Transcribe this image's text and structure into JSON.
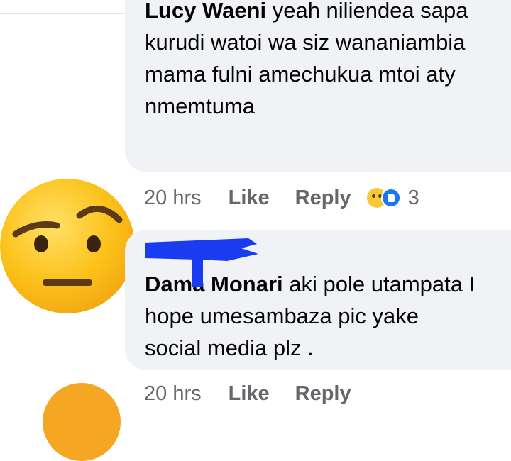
{
  "comments": [
    {
      "author": "Lucy Waeni",
      "text": " yeah niliendea sapa kurudi watoi wa siz wananiambia mama fulni amechukua mtoi aty nmemtuma",
      "time": "20 hrs",
      "like_label": "Like",
      "reply_label": "Reply",
      "reaction_count": "3",
      "reaction_icons": [
        "sad-face-icon",
        "like-thumb-icon"
      ]
    },
    {
      "author": "Dama Monari",
      "text": " aki pole utampata I hope umesambaza pic yake social media plz .",
      "mention_redacted": true
    },
    {
      "time": "20 hrs",
      "like_label": "Like",
      "reply_label": "Reply"
    }
  ],
  "colors": {
    "bubble": "#f0f2f5",
    "meta_text": "#65676b",
    "redaction": "#1a3cf0"
  }
}
